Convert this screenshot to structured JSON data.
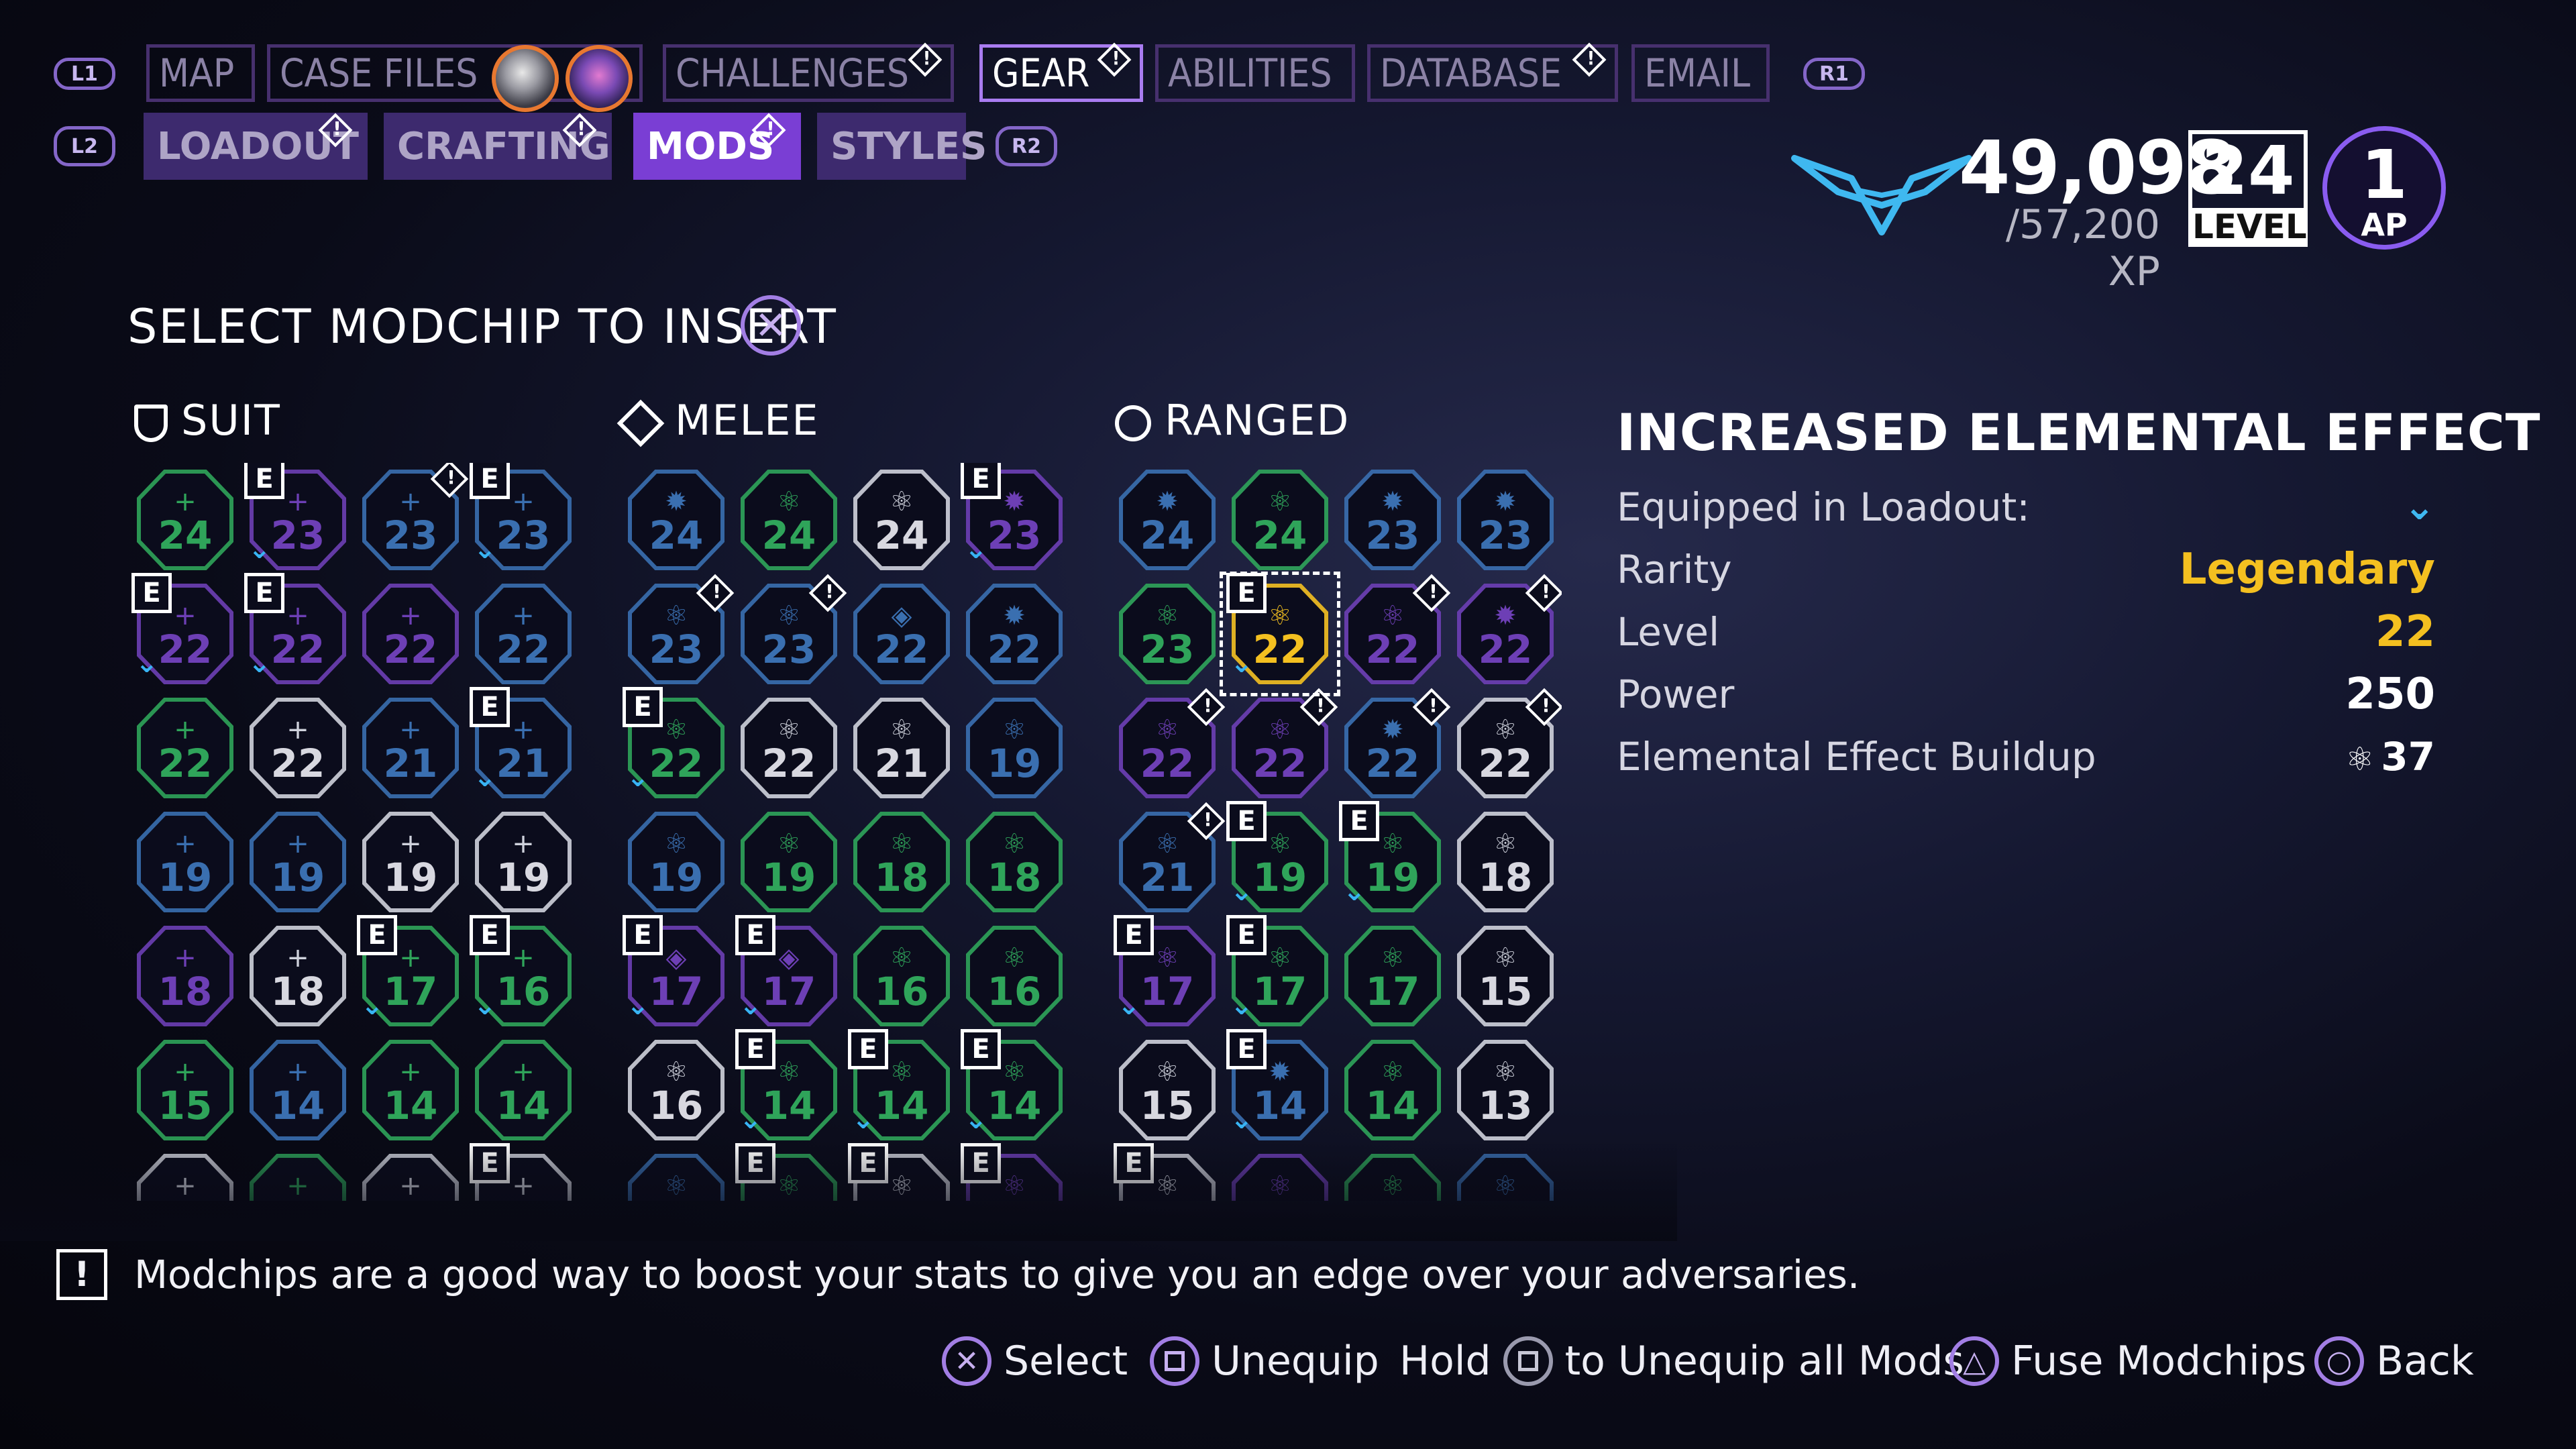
{
  "nav": {
    "l1": "L1",
    "r1": "R1",
    "l2": "L2",
    "r2": "R2",
    "tabs": [
      "MAP",
      "CASE FILES",
      "CHALLENGES",
      "GEAR",
      "ABILITIES",
      "DATABASE",
      "EMAIL"
    ],
    "active_tab": "GEAR",
    "subtabs": [
      "LOADOUT",
      "CRAFTING",
      "MODS",
      "STYLES"
    ],
    "active_subtab": "MODS"
  },
  "player": {
    "xp": "49,098",
    "xp_max": "/57,200 XP",
    "level": "24",
    "level_label": "LEVEL",
    "ap": "1",
    "ap_label": "AP"
  },
  "header": {
    "title": "SELECT MODCHIP TO INSERT"
  },
  "sections": {
    "suit": "SUIT",
    "melee": "MELEE",
    "ranged": "RANGED"
  },
  "suit_chips": [
    {
      "lvl": "24",
      "c": "green",
      "g": "+"
    },
    {
      "lvl": "23",
      "c": "purple",
      "g": "+",
      "e": true,
      "m": true
    },
    {
      "lvl": "23",
      "c": "blue",
      "g": "+",
      "a": true
    },
    {
      "lvl": "23",
      "c": "blue",
      "g": "+",
      "e": true,
      "m": true
    },
    {
      "lvl": "22",
      "c": "purple",
      "g": "+",
      "e": true,
      "m": true
    },
    {
      "lvl": "22",
      "c": "purple",
      "g": "+",
      "e": true,
      "m": true
    },
    {
      "lvl": "22",
      "c": "purple",
      "g": "+"
    },
    {
      "lvl": "22",
      "c": "blue",
      "g": "+"
    },
    {
      "lvl": "22",
      "c": "green",
      "g": "+"
    },
    {
      "lvl": "22",
      "c": "white",
      "g": "+"
    },
    {
      "lvl": "21",
      "c": "blue",
      "g": "+"
    },
    {
      "lvl": "21",
      "c": "blue",
      "g": "+",
      "e": true,
      "m": true
    },
    {
      "lvl": "19",
      "c": "blue",
      "g": "+"
    },
    {
      "lvl": "19",
      "c": "blue",
      "g": "+"
    },
    {
      "lvl": "19",
      "c": "white",
      "g": "+"
    },
    {
      "lvl": "19",
      "c": "white",
      "g": "+"
    },
    {
      "lvl": "18",
      "c": "purple",
      "g": "+"
    },
    {
      "lvl": "18",
      "c": "white",
      "g": "+"
    },
    {
      "lvl": "17",
      "c": "green",
      "g": "+",
      "e": true,
      "m": true
    },
    {
      "lvl": "16",
      "c": "green",
      "g": "+",
      "e": true,
      "m": true
    },
    {
      "lvl": "15",
      "c": "green",
      "g": "+"
    },
    {
      "lvl": "14",
      "c": "blue",
      "g": "+"
    },
    {
      "lvl": "14",
      "c": "green",
      "g": "+"
    },
    {
      "lvl": "14",
      "c": "green",
      "g": "+"
    },
    {
      "lvl": "",
      "c": "white",
      "g": "+"
    },
    {
      "lvl": "",
      "c": "green",
      "g": "+"
    },
    {
      "lvl": "",
      "c": "white",
      "g": "+"
    },
    {
      "lvl": "",
      "c": "white",
      "g": "+",
      "e": true
    }
  ],
  "melee_chips": [
    {
      "lvl": "24",
      "c": "blue",
      "g": "✹"
    },
    {
      "lvl": "24",
      "c": "green",
      "g": "⚛"
    },
    {
      "lvl": "24",
      "c": "white",
      "g": "⚛"
    },
    {
      "lvl": "23",
      "c": "purple",
      "g": "✹",
      "e": true,
      "m": true
    },
    {
      "lvl": "23",
      "c": "blue",
      "g": "⚛",
      "a": true
    },
    {
      "lvl": "23",
      "c": "blue",
      "g": "⚛",
      "a": true
    },
    {
      "lvl": "22",
      "c": "blue",
      "g": "◈"
    },
    {
      "lvl": "22",
      "c": "blue",
      "g": "✹"
    },
    {
      "lvl": "22",
      "c": "green",
      "g": "⚛",
      "e": true,
      "m": true
    },
    {
      "lvl": "22",
      "c": "white",
      "g": "⚛"
    },
    {
      "lvl": "21",
      "c": "white",
      "g": "⚛"
    },
    {
      "lvl": "19",
      "c": "blue",
      "g": "⚛"
    },
    {
      "lvl": "19",
      "c": "blue",
      "g": "⚛"
    },
    {
      "lvl": "19",
      "c": "green",
      "g": "⚛"
    },
    {
      "lvl": "18",
      "c": "green",
      "g": "⚛"
    },
    {
      "lvl": "18",
      "c": "green",
      "g": "⚛"
    },
    {
      "lvl": "17",
      "c": "purple",
      "g": "◈",
      "e": true,
      "m": true
    },
    {
      "lvl": "17",
      "c": "purple",
      "g": "◈",
      "e": true,
      "m": true
    },
    {
      "lvl": "16",
      "c": "green",
      "g": "⚛"
    },
    {
      "lvl": "16",
      "c": "green",
      "g": "⚛"
    },
    {
      "lvl": "16",
      "c": "white",
      "g": "⚛"
    },
    {
      "lvl": "14",
      "c": "green",
      "g": "⚛",
      "e": true,
      "m": true
    },
    {
      "lvl": "14",
      "c": "green",
      "g": "⚛",
      "e": true,
      "m": true
    },
    {
      "lvl": "14",
      "c": "green",
      "g": "⚛",
      "e": true,
      "m": true
    },
    {
      "lvl": "",
      "c": "blue",
      "g": "⚛"
    },
    {
      "lvl": "",
      "c": "green",
      "g": "⚛",
      "e": true
    },
    {
      "lvl": "",
      "c": "white",
      "g": "⚛",
      "e": true
    },
    {
      "lvl": "",
      "c": "purple",
      "g": "⚛",
      "e": true
    }
  ],
  "ranged_chips": [
    {
      "lvl": "24",
      "c": "blue",
      "g": "✹"
    },
    {
      "lvl": "24",
      "c": "green",
      "g": "⚛"
    },
    {
      "lvl": "23",
      "c": "blue",
      "g": "✹"
    },
    {
      "lvl": "23",
      "c": "blue",
      "g": "✹"
    },
    {
      "lvl": "23",
      "c": "green",
      "g": "⚛"
    },
    {
      "lvl": "22",
      "c": "gold",
      "g": "⚛",
      "e": true,
      "m": true,
      "sel": true
    },
    {
      "lvl": "22",
      "c": "purple",
      "g": "⚛",
      "a": true
    },
    {
      "lvl": "22",
      "c": "purple",
      "g": "✹",
      "a": true
    },
    {
      "lvl": "22",
      "c": "purple",
      "g": "⚛",
      "a": true
    },
    {
      "lvl": "22",
      "c": "purple",
      "g": "⚛",
      "a": true
    },
    {
      "lvl": "22",
      "c": "blue",
      "g": "✹",
      "a": true
    },
    {
      "lvl": "22",
      "c": "white",
      "g": "⚛",
      "a": true
    },
    {
      "lvl": "21",
      "c": "blue",
      "g": "⚛",
      "a": true
    },
    {
      "lvl": "19",
      "c": "green",
      "g": "⚛",
      "e": true,
      "m": true
    },
    {
      "lvl": "19",
      "c": "green",
      "g": "⚛",
      "e": true,
      "m": true
    },
    {
      "lvl": "18",
      "c": "white",
      "g": "⚛"
    },
    {
      "lvl": "17",
      "c": "purple",
      "g": "⚛",
      "e": true,
      "m": true
    },
    {
      "lvl": "17",
      "c": "green",
      "g": "⚛",
      "e": true,
      "m": true
    },
    {
      "lvl": "17",
      "c": "green",
      "g": "⚛"
    },
    {
      "lvl": "15",
      "c": "white",
      "g": "⚛"
    },
    {
      "lvl": "15",
      "c": "white",
      "g": "⚛"
    },
    {
      "lvl": "14",
      "c": "blue",
      "g": "✹",
      "e": true,
      "m": true
    },
    {
      "lvl": "14",
      "c": "green",
      "g": "⚛"
    },
    {
      "lvl": "13",
      "c": "white",
      "g": "⚛"
    },
    {
      "lvl": "",
      "c": "white",
      "g": "⚛",
      "e": true
    },
    {
      "lvl": "",
      "c": "purple",
      "g": "⚛"
    },
    {
      "lvl": "",
      "c": "green",
      "g": "⚛"
    },
    {
      "lvl": "",
      "c": "blue",
      "g": "⚛"
    }
  ],
  "details": {
    "title": "INCREASED ELEMENTAL EFFECT",
    "equipped_label": "Equipped in Loadout:",
    "rarity_label": "Rarity",
    "rarity_value": "Legendary",
    "level_label": "Level",
    "level_value": "22",
    "power_label": "Power",
    "power_value": "250",
    "buildup_label": "Elemental Effect Buildup",
    "buildup_value": "37"
  },
  "colors": {
    "accent": "#8a5cf0",
    "legendary": "#f4c020",
    "equipped_mark": "#38b4f4"
  },
  "footer": {
    "tip": "Modchips are a good way to boost your stats to give you an edge over your adversaries.",
    "select": "Select",
    "unequip": "Unequip",
    "hold": "Hold",
    "unequip_all": "to Unequip all Mods",
    "fuse": "Fuse Modchips",
    "back": "Back"
  }
}
